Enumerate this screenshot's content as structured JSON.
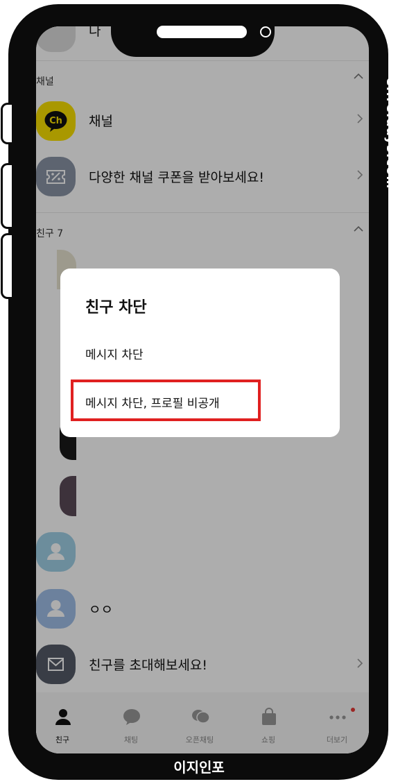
{
  "side_watermark": "ei.reidays.com",
  "brand": "이지인포",
  "top_partial_label": "나",
  "sections": {
    "channel_header": "채널",
    "friends_header": "친구 7"
  },
  "channel_rows": [
    {
      "label": "채널",
      "icon": "kakao-channel-icon"
    },
    {
      "label": "다양한 채널 쿠폰을 받아보세요!",
      "icon": "coupon-ticket-icon"
    }
  ],
  "friend_rows": [
    {
      "label": "ㅇㅇ",
      "icon": "default-avatar-icon"
    },
    {
      "label": "친구를 초대해보세요!",
      "icon": "envelope-icon"
    }
  ],
  "dialog": {
    "title": "친구 차단",
    "options": [
      "메시지 차단",
      "메시지 차단, 프로필 비공개"
    ]
  },
  "tabs": [
    {
      "label": "친구",
      "icon": "person-icon"
    },
    {
      "label": "채팅",
      "icon": "chat-bubble-icon"
    },
    {
      "label": "오픈채팅",
      "icon": "open-chat-icon"
    },
    {
      "label": "쇼핑",
      "icon": "shopping-bag-icon"
    },
    {
      "label": "더보기",
      "icon": "more-dots-icon"
    }
  ],
  "colors": {
    "highlight": "#e02020",
    "kakao_yellow": "#fae100",
    "notification_dot": "#e53935"
  }
}
